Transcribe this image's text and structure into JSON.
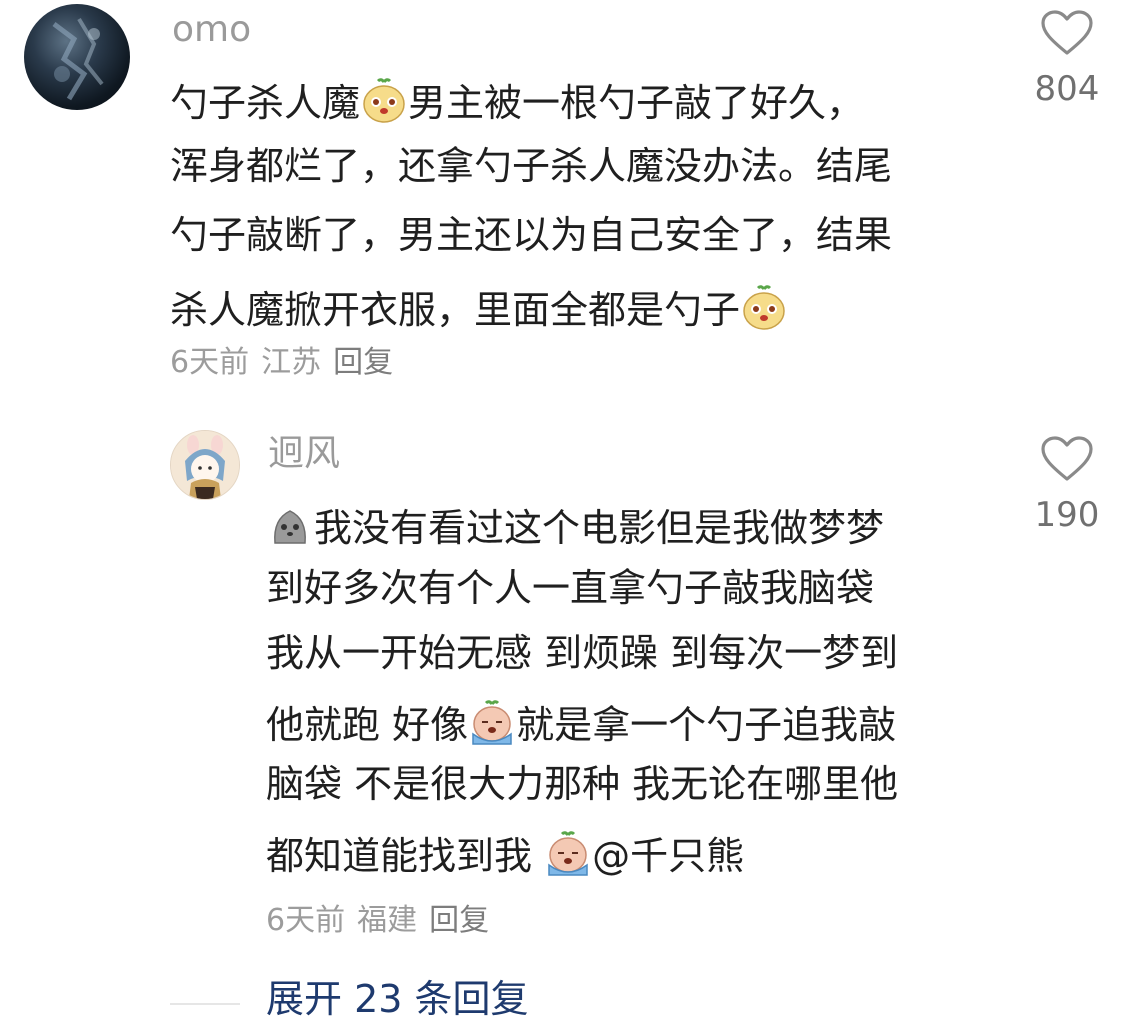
{
  "comments": [
    {
      "username": "omo",
      "likes": "804",
      "lines": [
        {
          "segments": [
            {
              "text": "勺子杀人魔"
            },
            {
              "emoji": "smiling-radish-emoji"
            },
            {
              "text": "男主被一根勺子敲了好久，"
            }
          ]
        },
        {
          "segments": [
            {
              "text": "浑身都烂了，还拿勺子杀人魔没办法。结尾"
            }
          ]
        },
        {
          "segments": [
            {
              "text": "勺子敲断了，男主还以为自己安全了，结果"
            }
          ]
        },
        {
          "segments": [
            {
              "text": "杀人魔掀开衣服，里面全都是勺子"
            },
            {
              "emoji": "smiling-radish-emoji"
            }
          ]
        }
      ],
      "time": "6天前",
      "location": "江苏",
      "reply_label": "回复"
    },
    {
      "username": "迥风",
      "likes": "190",
      "lines": [
        {
          "segments": [
            {
              "emoji": "gray-blob-emoji"
            },
            {
              "text": "我没有看过这个电影但是我做梦梦"
            }
          ]
        },
        {
          "segments": [
            {
              "text": "到好多次有个人一直拿勺子敲我脑袋"
            }
          ]
        },
        {
          "segments": [
            {
              "text": "我从一开始无感 到烦躁 到每次一梦到"
            }
          ]
        },
        {
          "segments": [
            {
              "text": "他就跑 好像"
            },
            {
              "emoji": "crying-radish-emoji"
            },
            {
              "text": "就是拿一个勺子追我敲"
            }
          ]
        },
        {
          "segments": [
            {
              "text": "脑袋 不是很大力那种 我无论在哪里他"
            }
          ]
        },
        {
          "segments": [
            {
              "text": "都知道能找到我 "
            },
            {
              "emoji": "crying-radish-emoji"
            },
            {
              "text": "@千只熊"
            }
          ]
        }
      ],
      "time": "6天前",
      "location": "福建",
      "reply_label": "回复"
    }
  ],
  "expand_replies_label": "展开 23 条回复",
  "colors": {
    "text": "#1f1f1f",
    "meta": "#9c9c9c",
    "link": "#1e3a6e"
  }
}
